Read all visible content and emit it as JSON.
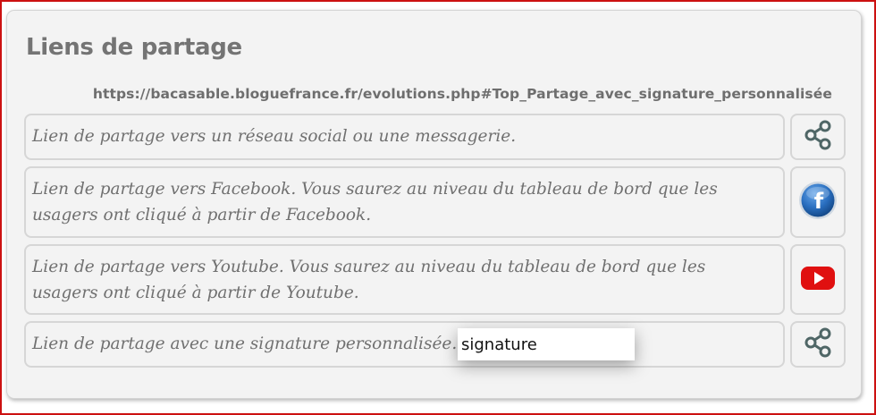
{
  "title": "Liens de partage",
  "url": "https://bacasable.bloguefrance.fr/evolutions.php#Top_Partage_avec_signature_personnalisée",
  "rows": [
    {
      "text": "Lien de partage vers un réseau social ou une messagerie.",
      "icon": "share-icon"
    },
    {
      "text": "Lien de partage vers Facebook. Vous saurez au niveau du tableau de bord que les usagers ont cliqué à partir de Facebook.",
      "icon": "facebook-icon"
    },
    {
      "text": "Lien de partage vers Youtube. Vous saurez au niveau du tableau de bord que les usagers ont cliqué à partir de Youtube.",
      "icon": "youtube-icon"
    },
    {
      "text": "Lien de partage avec une signature personnalisée.",
      "icon": "share-icon"
    }
  ],
  "signature_input": {
    "value": "signature"
  },
  "colors": {
    "frame_border": "#cc1111",
    "panel_bg": "#f3f3f3",
    "facebook_blue": "#2a6fc0",
    "youtube_red": "#e01010",
    "share_icon": "#4f6666"
  }
}
